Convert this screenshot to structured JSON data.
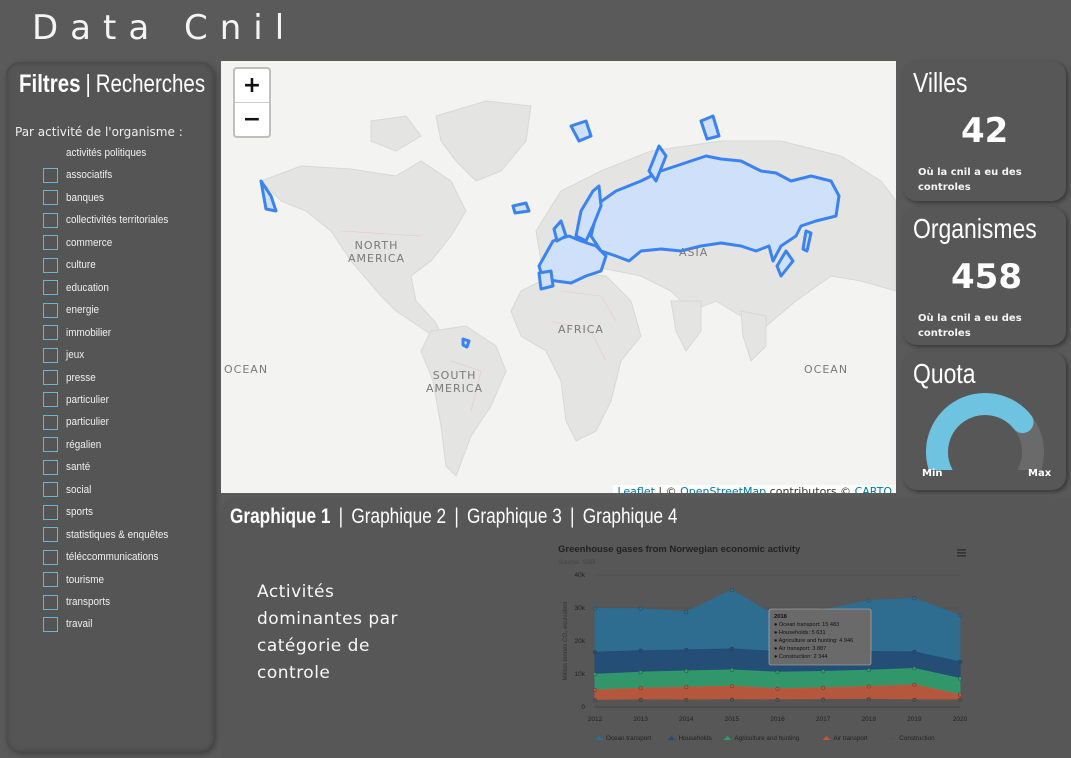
{
  "app": {
    "title": "Data Cnil"
  },
  "sidebar": {
    "tabs": [
      {
        "label": "Filtres",
        "active": true
      },
      {
        "label": "Recherches",
        "active": false
      }
    ],
    "separator": "|",
    "filter_heading": "Par activité de l'organisme :",
    "filters": [
      "activités politiques",
      "associatifs",
      "banques",
      "collectivités territoriales",
      "commerce",
      "culture",
      "education",
      "energie",
      "immobilier",
      "jeux",
      "presse",
      "particulier",
      "particulier",
      "régalien",
      "santé",
      "social",
      "sports",
      "statistiques & enquêtes",
      "téléccommunications",
      "tourisme",
      "transports",
      "travail"
    ]
  },
  "map": {
    "zoom_in": "+",
    "zoom_out": "−",
    "labels": {
      "north_america": "NORTH\nAMERICA",
      "south_america": "SOUTH\nAMERICA",
      "africa": "AFRICA",
      "asia": "ASIA",
      "ocean_left": "OCEAN",
      "ocean_right": "OCEAN"
    },
    "attribution": {
      "leaflet": "Leaflet",
      "sep": " | © ",
      "osm": "OpenStreetMap",
      "contrib": " contributors © ",
      "carto": "CARTO"
    },
    "highlight_color": "#3b82f6",
    "fill_color": "#cfe0fb"
  },
  "cards": {
    "villes": {
      "title": "Villes",
      "value": "42",
      "note": "Où la cnil a eu des controles"
    },
    "organismes": {
      "title": "Organismes",
      "value": "458",
      "note": "Où la cnil a eu des controles"
    },
    "quota": {
      "title": "Quota",
      "min_label": "Min",
      "max_label": "Max",
      "level": 0.72,
      "gauge_color": "#6ec3e1"
    }
  },
  "chart_panel": {
    "tabs": [
      {
        "label": "Graphique 1",
        "active": true
      },
      {
        "label": "Graphique 2"
      },
      {
        "label": "Graphique 3"
      },
      {
        "label": "Graphique 4"
      }
    ],
    "separator": "|",
    "caption": "Activités dominantes par catégorie de controle"
  },
  "chart_data": {
    "type": "area",
    "title": "Greenhouse gases from Norwegian economic activity",
    "subtitle": "Source: SSB",
    "ylabel": "Million tonnes CO₂ equivalent",
    "x": [
      "2012",
      "2013",
      "2014",
      "2015",
      "2016",
      "2017",
      "2018",
      "2019",
      "2020"
    ],
    "ylim": [
      0,
      40000
    ],
    "yticks": [
      "0",
      "10k",
      "20k",
      "30k",
      "40k"
    ],
    "stacked": true,
    "legend_position": "bottom",
    "series": [
      {
        "name": "Ocean transport",
        "color": "#2a6f97",
        "values": [
          13234,
          12729,
          11533,
          17798,
          10398,
          12811,
          15483,
          16196,
          14053
        ]
      },
      {
        "name": "Households",
        "color": "#1f4e79",
        "values": [
          6685,
          6535,
          6389,
          6384,
          6251,
          5725,
          5631,
          5047,
          5039
        ]
      },
      {
        "name": "Agriculture and hunting",
        "color": "#2e9e6e",
        "values": [
          4752,
          4820,
          4877,
          4925,
          5006,
          4976,
          4946,
          4911,
          4913
        ]
      },
      {
        "name": "Air transport",
        "color": "#c0583a",
        "values": [
          3164,
          3541,
          3898,
          4115,
          3388,
          3569,
          3887,
          4593,
          1550
        ]
      },
      {
        "name": "Construction",
        "color": "#555555",
        "values": [
          2019,
          2189,
          2150,
          2217,
          2175,
          2257,
          2344,
          2176,
          2186
        ]
      }
    ],
    "tooltip": {
      "year": "2018",
      "lines": [
        "Ocean transport: 15 483",
        "Households: 5 631",
        "Agriculture and hunting: 4 946",
        "Air transport: 3 887",
        "Construction: 2 344"
      ]
    },
    "menu_icon": "hamburger-icon"
  }
}
